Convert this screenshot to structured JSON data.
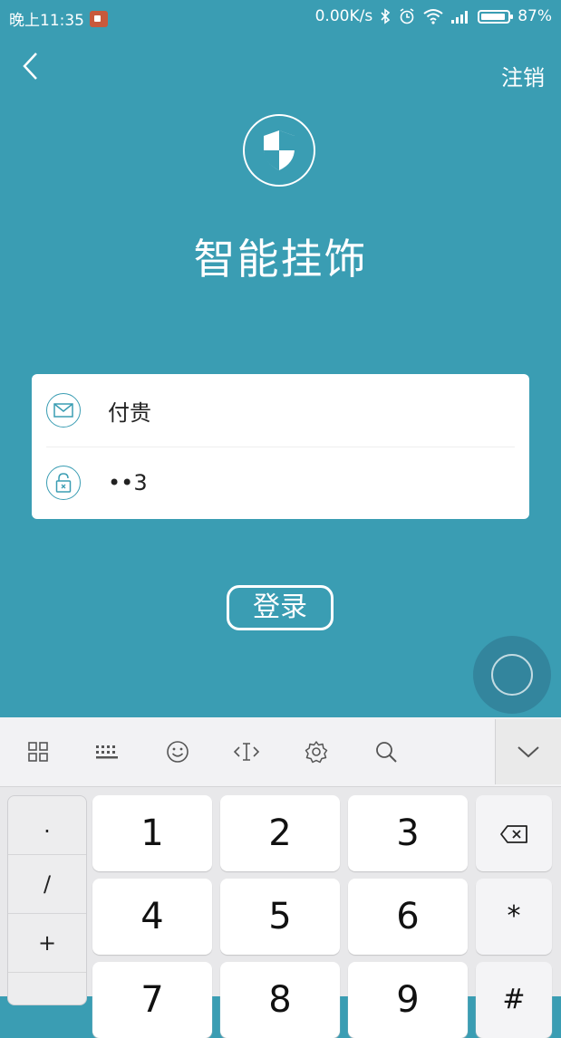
{
  "status_bar": {
    "time": "晚上11:35",
    "net_speed": "0.00K/s",
    "battery": "87%",
    "battery_level": 0.87
  },
  "header": {
    "logout_label": "注销",
    "app_title": "智能挂饰",
    "shield_icon": "shield-icon"
  },
  "form": {
    "account_value": "付贵",
    "password_value": "••3",
    "account_icon": "mail-icon",
    "password_icon": "lock-icon"
  },
  "login_button": "登录",
  "keyboard": {
    "symbols": [
      ".",
      "/",
      "+"
    ],
    "digits": [
      "1",
      "2",
      "3",
      "4",
      "5",
      "6",
      "7",
      "8",
      "9"
    ],
    "multiply": "*",
    "hash": "#"
  }
}
